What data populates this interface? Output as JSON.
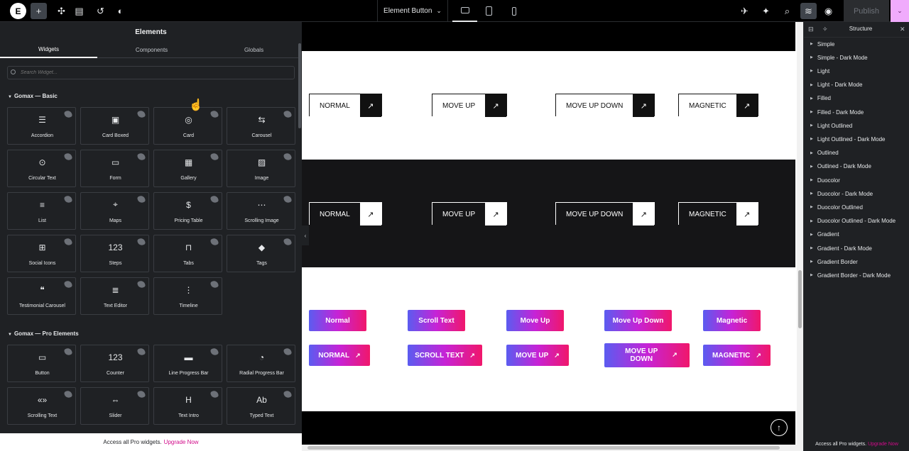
{
  "topbar": {
    "logo": "E",
    "document_title": "Element Button",
    "publish_label": "Publish",
    "icons": [
      "add-icon",
      "structure-move-icon",
      "page-settings-icon",
      "history-icon",
      "theme-style-icon"
    ],
    "right_icons": [
      "rocket-icon",
      "ai-sparkle-icon",
      "search-icon",
      "layers-icon",
      "preview-eye-icon"
    ]
  },
  "left_panel": {
    "title": "Elements",
    "tabs": [
      {
        "label": "Widgets",
        "active": true
      },
      {
        "label": "Components"
      },
      {
        "label": "Globals"
      }
    ],
    "search_placeholder": "Search Widget...",
    "categories": [
      {
        "title": "Gomax — Basic",
        "widgets": [
          {
            "label": "Accordion",
            "icon": "accordion-icon"
          },
          {
            "label": "Card Boxed",
            "icon": "card-boxed-icon"
          },
          {
            "label": "Card",
            "icon": "card-icon"
          },
          {
            "label": "Carousel",
            "icon": "carousel-icon"
          },
          {
            "label": "Circular Text",
            "icon": "circular-text-icon"
          },
          {
            "label": "Form",
            "icon": "form-icon"
          },
          {
            "label": "Gallery",
            "icon": "gallery-icon"
          },
          {
            "label": "Image",
            "icon": "image-icon"
          },
          {
            "label": "List",
            "icon": "list-icon"
          },
          {
            "label": "Maps",
            "icon": "maps-icon"
          },
          {
            "label": "Pricing Table",
            "icon": "pricing-table-icon"
          },
          {
            "label": "Scrolling Image",
            "icon": "scrolling-image-icon"
          },
          {
            "label": "Social Icons",
            "icon": "social-icons-icon"
          },
          {
            "label": "Steps",
            "icon": "steps-icon"
          },
          {
            "label": "Tabs",
            "icon": "tabs-icon"
          },
          {
            "label": "Tags",
            "icon": "tags-icon"
          },
          {
            "label": "Testimonial Carousel",
            "icon": "testimonial-carousel-icon"
          },
          {
            "label": "Text Editor",
            "icon": "text-editor-icon"
          },
          {
            "label": "Timeline",
            "icon": "timeline-icon"
          }
        ]
      },
      {
        "title": "Gomax — Pro Elements",
        "widgets": [
          {
            "label": "Button",
            "icon": "button-icon"
          },
          {
            "label": "Counter",
            "icon": "counter-icon"
          },
          {
            "label": "Line Progress Bar",
            "icon": "line-progress-bar-icon"
          },
          {
            "label": "Radial Progress Bar",
            "icon": "radial-progress-bar-icon"
          },
          {
            "label": "Scrolling Text",
            "icon": "scrolling-text-icon"
          },
          {
            "label": "Slider",
            "icon": "slider-icon"
          },
          {
            "label": "Text Intro",
            "icon": "text-intro-icon"
          },
          {
            "label": "Typed Text",
            "icon": "typed-text-icon"
          }
        ]
      }
    ],
    "footer_text": "Access all Pro widgets.",
    "footer_link": "Upgrade Now"
  },
  "canvas": {
    "light_row": [
      {
        "label": "NORMAL"
      },
      {
        "label": "MOVE UP"
      },
      {
        "label": "MOVE UP DOWN"
      },
      {
        "label": "MAGNETIC"
      }
    ],
    "dark_row": [
      {
        "label": "NORMAL"
      },
      {
        "label": "MOVE UP"
      },
      {
        "label": "MOVE UP DOWN"
      },
      {
        "label": "MAGNETIC"
      }
    ],
    "gradient_row1": [
      {
        "label": "Normal"
      },
      {
        "label": "Scroll Text"
      },
      {
        "label": "Move Up"
      },
      {
        "label": "Move Up Down"
      },
      {
        "label": "Magnetic"
      }
    ],
    "gradient_row2": [
      {
        "label": "NORMAL"
      },
      {
        "label": "SCROLL TEXT"
      },
      {
        "label": "MOVE UP"
      },
      {
        "label": "MOVE UP DOWN"
      },
      {
        "label": "MAGNETIC"
      }
    ],
    "arrow": "↗",
    "scroll_top": "↑"
  },
  "right_panel": {
    "title": "Structure",
    "items": [
      "Simple",
      "Simple - Dark Mode",
      "Light",
      "Light - Dark Mode",
      "Filled",
      "Filled - Dark Mode",
      "Light Outlined",
      "Light Outlined - Dark Mode",
      "Outlined",
      "Outlined - Dark Mode",
      "Duocolor",
      "Duocolor - Dark Mode",
      "Duocolor Outlined",
      "Duocolor Outlined - Dark Mode",
      "Gradient",
      "Gradient - Dark Mode",
      "Gradient Border",
      "Gradient Border - Dark Mode"
    ],
    "footer_text": "Access all Pro widgets.",
    "footer_link": "Upgrade Now"
  }
}
